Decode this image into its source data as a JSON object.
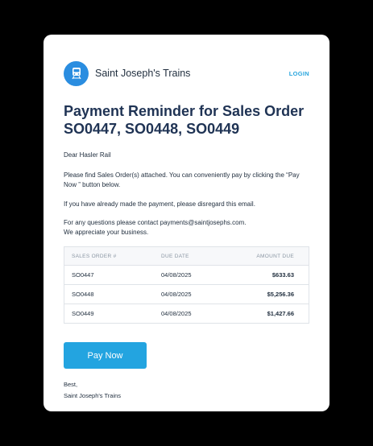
{
  "header": {
    "company_name": "Saint Joseph's Trains",
    "login_label": "LOGIN"
  },
  "email": {
    "title": "Payment Reminder for Sales Order SO0447, SO0448, SO0449",
    "greeting": "Dear Hasler Rail",
    "line_attached": "Please find Sales Order(s) attached. You can conveniently pay by clicking the “Pay Now ” button below.",
    "line_disregard": "If you have already made the payment, please disregard this email.",
    "line_questions": "For any questions please contact  payments@saintjosephs.com.",
    "line_appreciate": "We appreciate your business."
  },
  "table": {
    "headers": [
      "SALES ORDER #",
      "DUE DATE",
      "AMOUNT DUE"
    ],
    "rows": [
      [
        "SO0447",
        "04/08/2025",
        "$633.63"
      ],
      [
        "SO0448",
        "04/08/2025",
        "$5,256.36"
      ],
      [
        "SO0449",
        "04/08/2025",
        "$1,427.66"
      ]
    ]
  },
  "pay_button_label": "Pay Now",
  "signoff": {
    "closing": "Best,",
    "name": "Saint Joseph's Trains"
  },
  "colors": {
    "accent": "#23a4e0",
    "title": "#1f3354",
    "logo_bg": "#2a8de0"
  },
  "icons": {
    "logo": "train-icon"
  }
}
